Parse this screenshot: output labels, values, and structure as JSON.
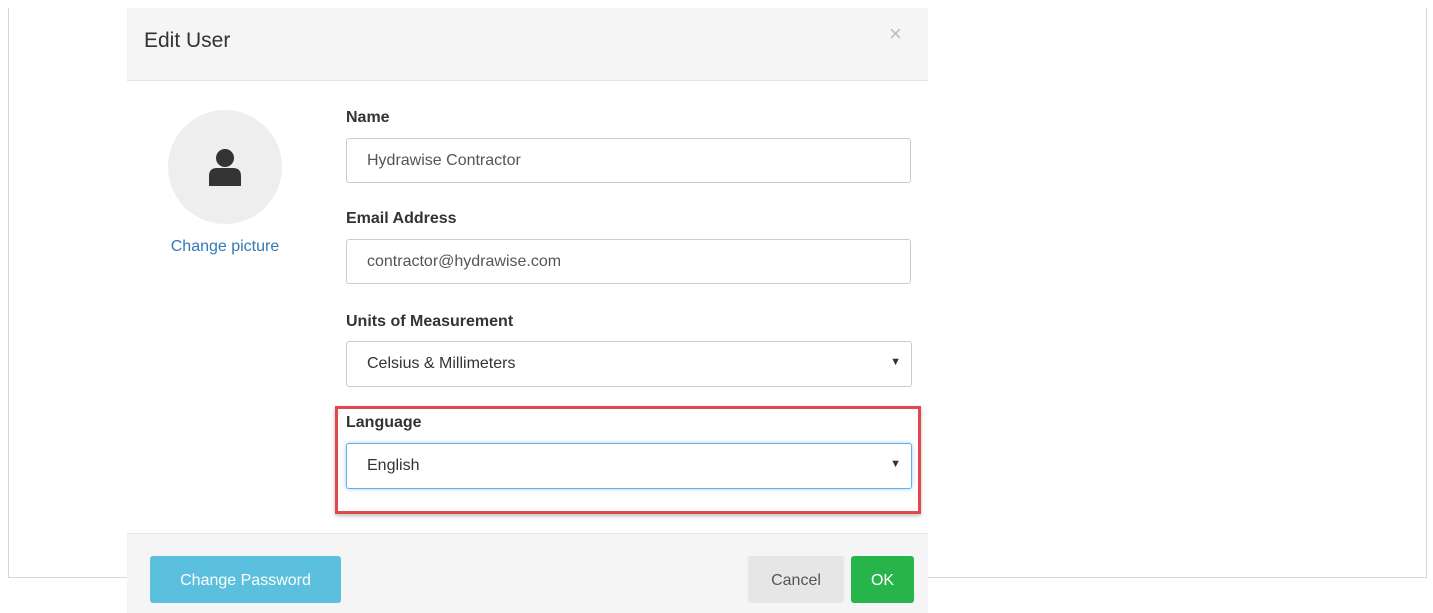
{
  "dialog": {
    "title": "Edit User",
    "close_symbol": "×",
    "close_icon": "close-icon"
  },
  "avatar": {
    "icon": "user-icon",
    "change_picture_label": "Change picture"
  },
  "form": {
    "name": {
      "label": "Name",
      "value": "Hydrawise Contractor"
    },
    "email": {
      "label": "Email Address",
      "value": "contractor@hydrawise.com"
    },
    "units": {
      "label": "Units of Measurement",
      "selected": "Celsius & Millimeters"
    },
    "language": {
      "label": "Language",
      "selected": "English",
      "highlighted": true
    }
  },
  "footer": {
    "change_password_label": "Change Password",
    "cancel_label": "Cancel",
    "ok_label": "OK"
  },
  "colors": {
    "link": "#337ab7",
    "info_button": "#5bc0de",
    "success_button": "#27b44a",
    "default_button": "#e6e6e6",
    "highlight_border": "#e0474c",
    "focus_border": "#66afe9"
  }
}
